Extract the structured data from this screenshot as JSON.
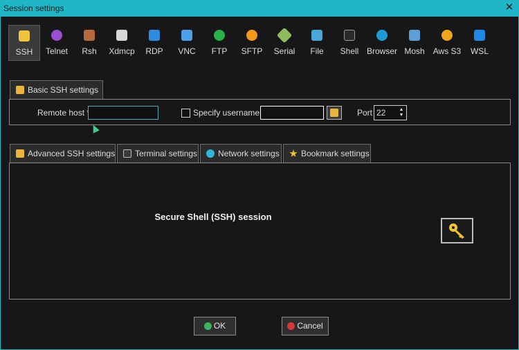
{
  "window": {
    "title": "Session settings",
    "close_icon": "close-icon"
  },
  "session_types": [
    {
      "label": "SSH",
      "icon": "ssh-key-icon",
      "active": true
    },
    {
      "label": "Telnet",
      "icon": "telnet-icon"
    },
    {
      "label": "Rsh",
      "icon": "rsh-icon"
    },
    {
      "label": "Xdmcp",
      "icon": "xdmcp-icon"
    },
    {
      "label": "RDP",
      "icon": "rdp-icon"
    },
    {
      "label": "VNC",
      "icon": "vnc-icon"
    },
    {
      "label": "FTP",
      "icon": "ftp-icon"
    },
    {
      "label": "SFTP",
      "icon": "sftp-icon"
    },
    {
      "label": "Serial",
      "icon": "serial-icon"
    },
    {
      "label": "File",
      "icon": "file-icon"
    },
    {
      "label": "Shell",
      "icon": "shell-icon"
    },
    {
      "label": "Browser",
      "icon": "browser-icon"
    },
    {
      "label": "Mosh",
      "icon": "mosh-icon"
    },
    {
      "label": "Aws S3",
      "icon": "aws-s3-icon"
    },
    {
      "label": "WSL",
      "icon": "wsl-icon"
    }
  ],
  "basic": {
    "tab_label": "Basic SSH settings",
    "remote_host_label": "Remote host *",
    "remote_host_value": "",
    "specify_username_label": "Specify username",
    "username_value": "",
    "port_label": "Port",
    "port_value": "22"
  },
  "lower_tabs": [
    {
      "label": "Advanced SSH settings",
      "icon": "wrench-icon"
    },
    {
      "label": "Terminal settings",
      "icon": "terminal-settings-icon"
    },
    {
      "label": "Network settings",
      "icon": "network-icon"
    },
    {
      "label": "Bookmark settings",
      "icon": "star-icon"
    }
  ],
  "description": "Secure Shell (SSH) session",
  "buttons": {
    "ok": "OK",
    "cancel": "Cancel"
  },
  "colors": {
    "accent": "#1fb7c6",
    "ok": "#3ab45a",
    "cancel": "#d93636",
    "key": "#f2c230"
  }
}
